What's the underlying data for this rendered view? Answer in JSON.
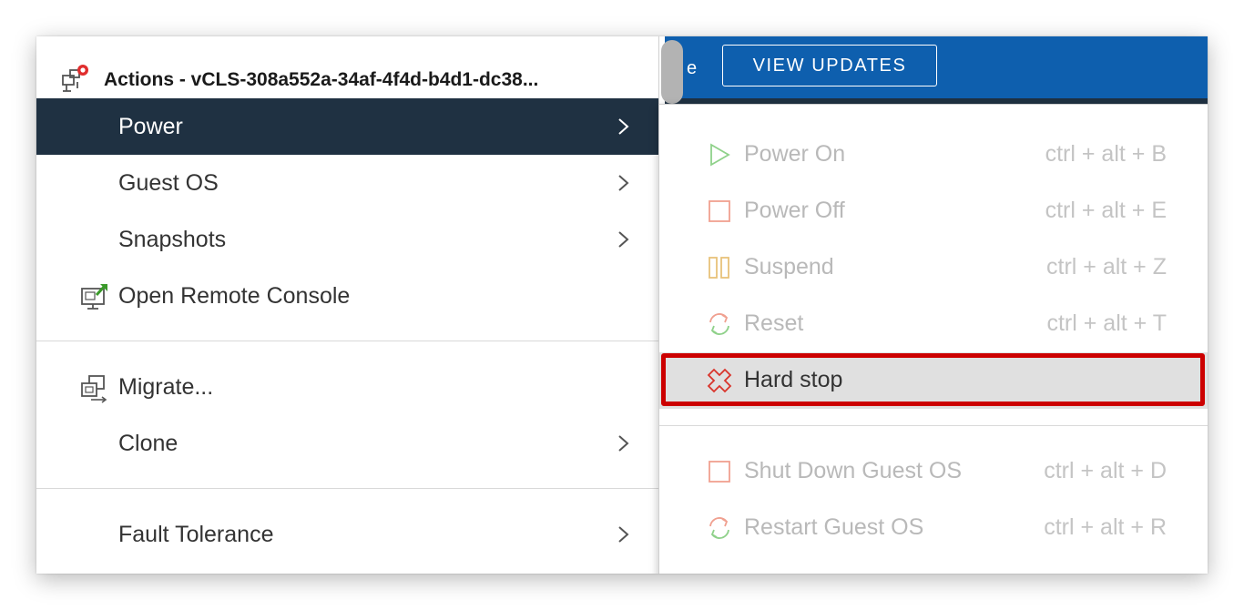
{
  "banner": {
    "partial_text": "e",
    "view_updates_label": "VIEW UPDATES"
  },
  "actions_menu": {
    "title": "Actions - vCLS-308a552a-34af-4f4d-b4d1-dc38...",
    "items": [
      {
        "label": "Power",
        "has_submenu": true,
        "active": true
      },
      {
        "label": "Guest OS",
        "has_submenu": true
      },
      {
        "label": "Snapshots",
        "has_submenu": true
      },
      {
        "label": "Open Remote Console",
        "icon": "remote-console-icon"
      },
      {
        "label": "Migrate...",
        "icon": "migrate-icon"
      },
      {
        "label": "Clone",
        "has_submenu": true
      },
      {
        "label": "Fault Tolerance",
        "has_submenu": true
      }
    ]
  },
  "power_submenu": {
    "items": [
      {
        "label": "Power On",
        "shortcut": "ctrl + alt + B",
        "icon": "play-icon"
      },
      {
        "label": "Power Off",
        "shortcut": "ctrl + alt + E",
        "icon": "stop-square-icon"
      },
      {
        "label": "Suspend",
        "shortcut": "ctrl + alt + Z",
        "icon": "pause-icon"
      },
      {
        "label": "Reset",
        "shortcut": "ctrl + alt + T",
        "icon": "reset-icon"
      },
      {
        "label": "Hard stop",
        "shortcut": "",
        "icon": "hard-stop-icon",
        "highlighted": true
      },
      {
        "label": "Shut Down Guest OS",
        "shortcut": "ctrl + alt + D",
        "icon": "stop-square-icon"
      },
      {
        "label": "Restart Guest OS",
        "shortcut": "ctrl + alt + R",
        "icon": "reset-icon"
      }
    ]
  },
  "colors": {
    "active_bg": "#1f3142",
    "banner_blue": "#0e5fae",
    "highlight_border": "#cc0000",
    "disabled_text": "#b9b9b9"
  }
}
